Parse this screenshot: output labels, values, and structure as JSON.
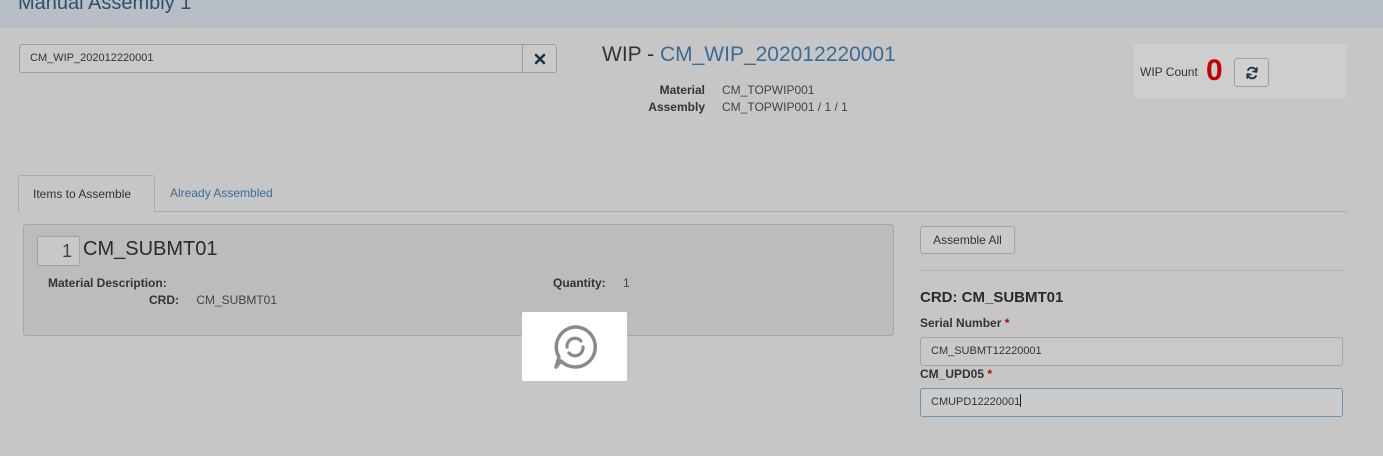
{
  "header": {
    "title": "Manual Assembly 1"
  },
  "search": {
    "value": "CM_WIP_202012220001"
  },
  "wip": {
    "prefix": "WIP - ",
    "id": "CM_WIP_202012220001",
    "material_label": "Material",
    "material_value": "CM_TOPWIP001",
    "assembly_label": "Assembly",
    "assembly_value": "CM_TOPWIP001 / 1 / 1"
  },
  "wip_count": {
    "label": "WIP Count",
    "value": "0"
  },
  "tabs": [
    {
      "label": "Items to Assemble",
      "active": true
    },
    {
      "label": "Already Assembled",
      "active": false
    }
  ],
  "item": {
    "number": "1",
    "name": "CM_SUBMT01",
    "material_description_label": "Material Description:",
    "material_description_value": "",
    "crd_label": "CRD:",
    "crd_value": "CM_SUBMT01",
    "quantity_label": "Quantity:",
    "quantity_value": "1"
  },
  "right_panel": {
    "assemble_all_label": "Assemble All",
    "crd_title": "CRD: CM_SUBMT01",
    "serial_label": "Serial Number",
    "serial_value": "CM_SUBMT12220001",
    "upd_label": "CM_UPD05",
    "upd_value": "CMUPD12220001",
    "required_mark": "*"
  },
  "icons": {
    "clear": "close-icon",
    "refresh": "refresh-icon",
    "loader": "loading-spinner-icon"
  },
  "colors": {
    "accent_blue": "#3a6c98",
    "wip_count_red": "#c40000",
    "required_red": "#c00000"
  }
}
